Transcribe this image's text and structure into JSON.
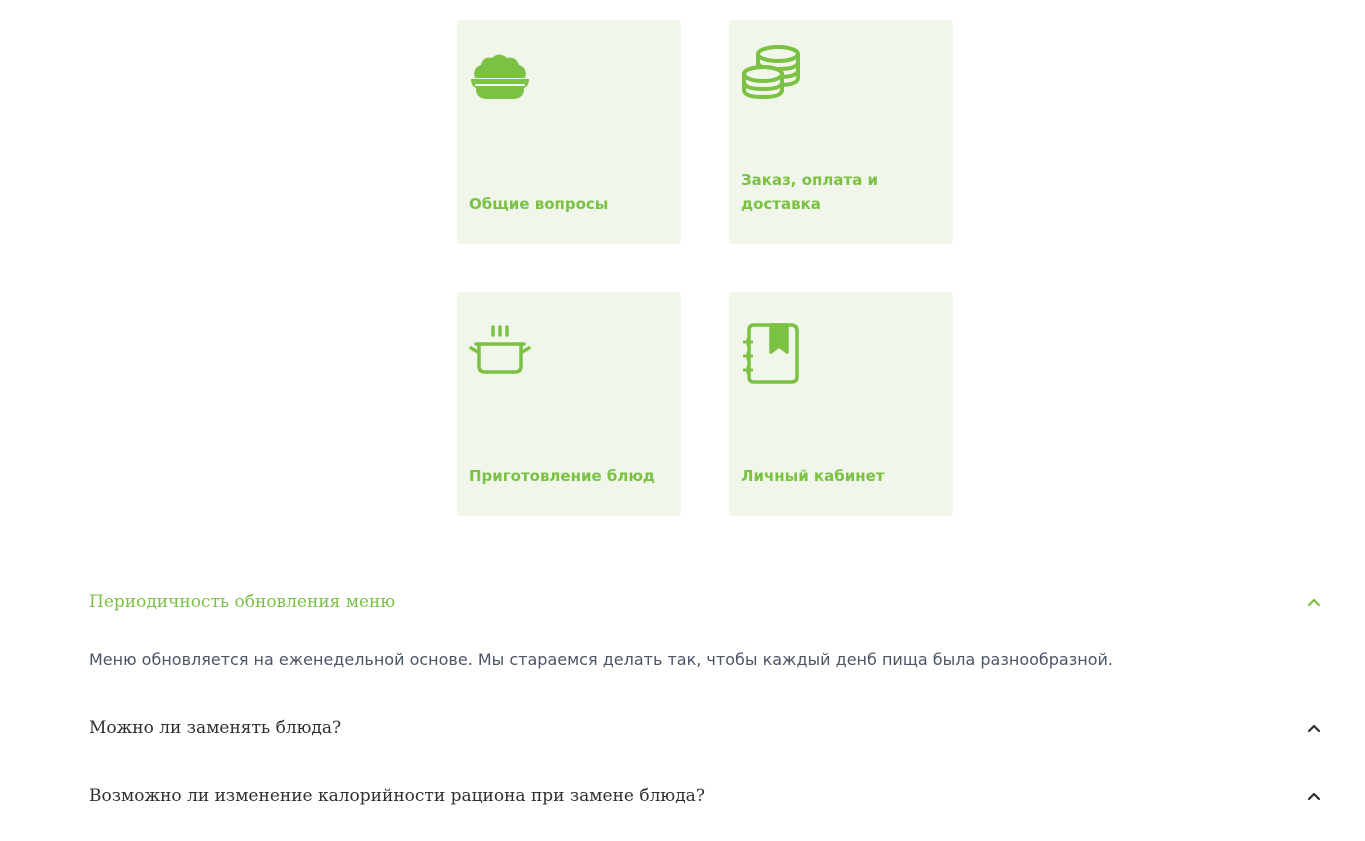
{
  "categories": [
    {
      "label": "Общие вопросы",
      "icon": "bowl-icon"
    },
    {
      "label": "Заказ, оплата и доставка",
      "icon": "coins-icon"
    },
    {
      "label": "Приготовление блюд",
      "icon": "cooking-pot-icon"
    },
    {
      "label": "Личный кабинет",
      "icon": "notebook-bookmark-icon"
    }
  ],
  "faq": [
    {
      "question": "Периодичность обновления меню",
      "answer": "Меню обновляется на еженедельной основе. Мы стараемся делать так, чтобы каждый денб пища была разнообразной.",
      "expanded": true
    },
    {
      "question": "Можно ли заменять блюда?",
      "expanded": false
    },
    {
      "question": "Возможно ли изменение калорийности рациона при замене блюда?",
      "expanded": false
    }
  ],
  "colors": {
    "accent": "#7bc142",
    "card_background": "#f0f6ea",
    "question_text": "#2f2f2f",
    "answer_text": "#4c5566"
  }
}
